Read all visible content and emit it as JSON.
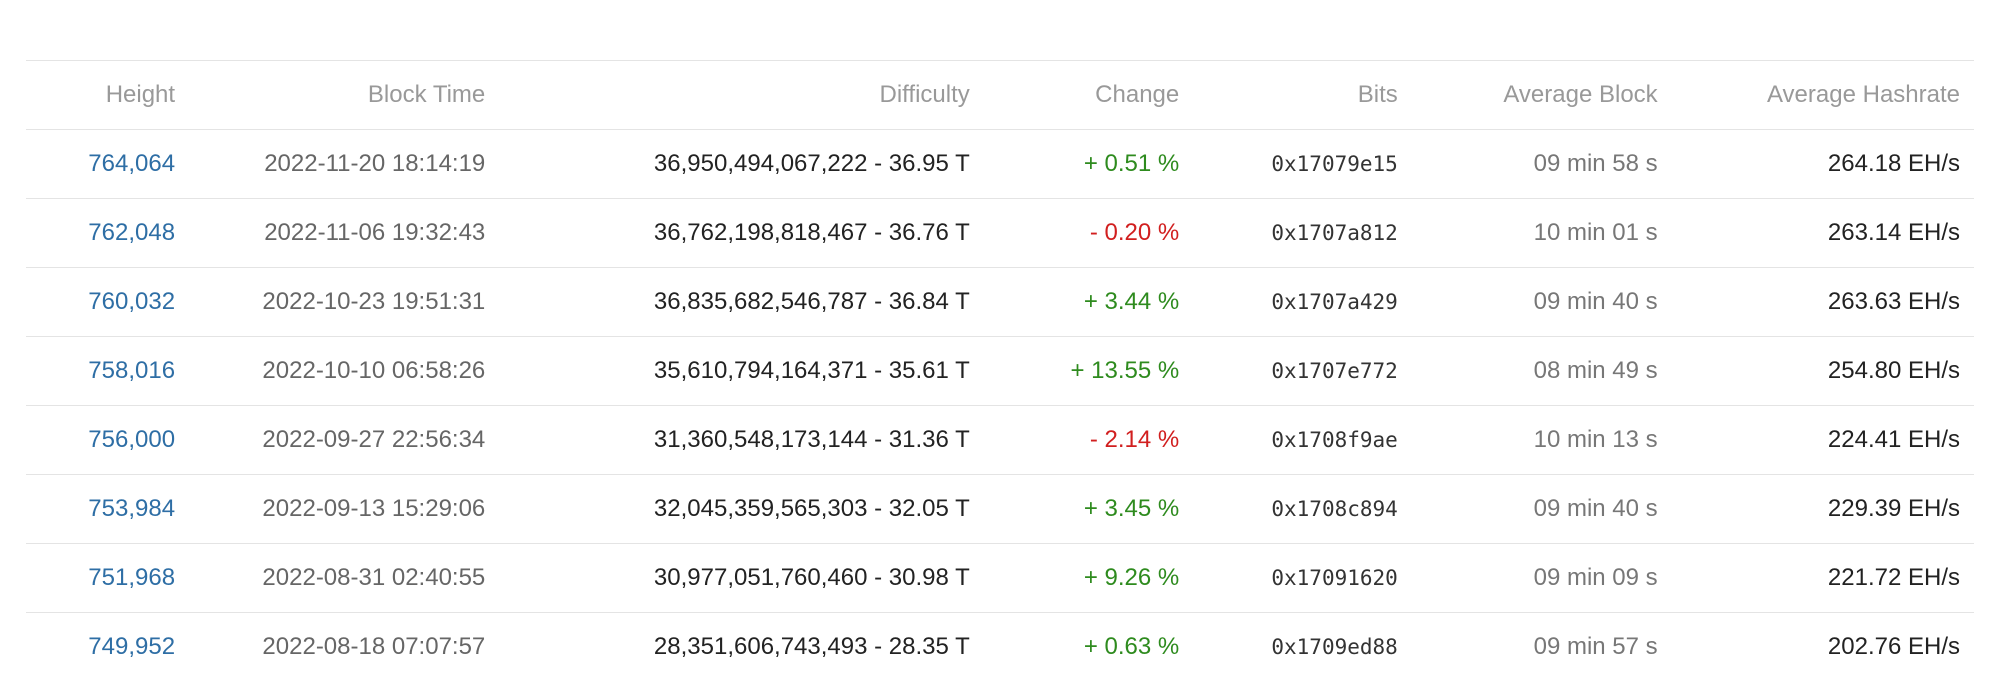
{
  "columns": {
    "height": "Height",
    "block_time": "Block Time",
    "difficulty": "Difficulty",
    "change": "Change",
    "bits": "Bits",
    "average_block": "Average Block",
    "average_hashrate": "Average Hashrate"
  },
  "rows": [
    {
      "height": "764,064",
      "block_time": "2022-11-20 18:14:19",
      "difficulty": "36,950,494,067,222 - 36.95 T",
      "change": "+ 0.51 %",
      "change_dir": "up",
      "bits": "0x17079e15",
      "average_block": "09 min 58 s",
      "average_hashrate": "264.18 EH/s"
    },
    {
      "height": "762,048",
      "block_time": "2022-11-06 19:32:43",
      "difficulty": "36,762,198,818,467 - 36.76 T",
      "change": "- 0.20 %",
      "change_dir": "down",
      "bits": "0x1707a812",
      "average_block": "10 min 01 s",
      "average_hashrate": "263.14 EH/s"
    },
    {
      "height": "760,032",
      "block_time": "2022-10-23 19:51:31",
      "difficulty": "36,835,682,546,787 - 36.84 T",
      "change": "+ 3.44 %",
      "change_dir": "up",
      "bits": "0x1707a429",
      "average_block": "09 min 40 s",
      "average_hashrate": "263.63 EH/s"
    },
    {
      "height": "758,016",
      "block_time": "2022-10-10 06:58:26",
      "difficulty": "35,610,794,164,371 - 35.61 T",
      "change": "+ 13.55 %",
      "change_dir": "up",
      "bits": "0x1707e772",
      "average_block": "08 min 49 s",
      "average_hashrate": "254.80 EH/s"
    },
    {
      "height": "756,000",
      "block_time": "2022-09-27 22:56:34",
      "difficulty": "31,360,548,173,144 - 31.36 T",
      "change": "- 2.14 %",
      "change_dir": "down",
      "bits": "0x1708f9ae",
      "average_block": "10 min 13 s",
      "average_hashrate": "224.41 EH/s"
    },
    {
      "height": "753,984",
      "block_time": "2022-09-13 15:29:06",
      "difficulty": "32,045,359,565,303 - 32.05 T",
      "change": "+ 3.45 %",
      "change_dir": "up",
      "bits": "0x1708c894",
      "average_block": "09 min 40 s",
      "average_hashrate": "229.39 EH/s"
    },
    {
      "height": "751,968",
      "block_time": "2022-08-31 02:40:55",
      "difficulty": "30,977,051,760,460 - 30.98 T",
      "change": "+ 9.26 %",
      "change_dir": "up",
      "bits": "0x17091620",
      "average_block": "09 min 09 s",
      "average_hashrate": "221.72 EH/s"
    },
    {
      "height": "749,952",
      "block_time": "2022-08-18 07:07:57",
      "difficulty": "28,351,606,743,493 - 28.35 T",
      "change": "+ 0.63 %",
      "change_dir": "up",
      "bits": "0x1709ed88",
      "average_block": "09 min 57 s",
      "average_hashrate": "202.76 EH/s"
    }
  ],
  "colors": {
    "link": "#2e6ea5",
    "positive": "#2e8b1e",
    "negative": "#d11f1f",
    "header_text": "#999999",
    "divider": "#e4e4e4"
  }
}
